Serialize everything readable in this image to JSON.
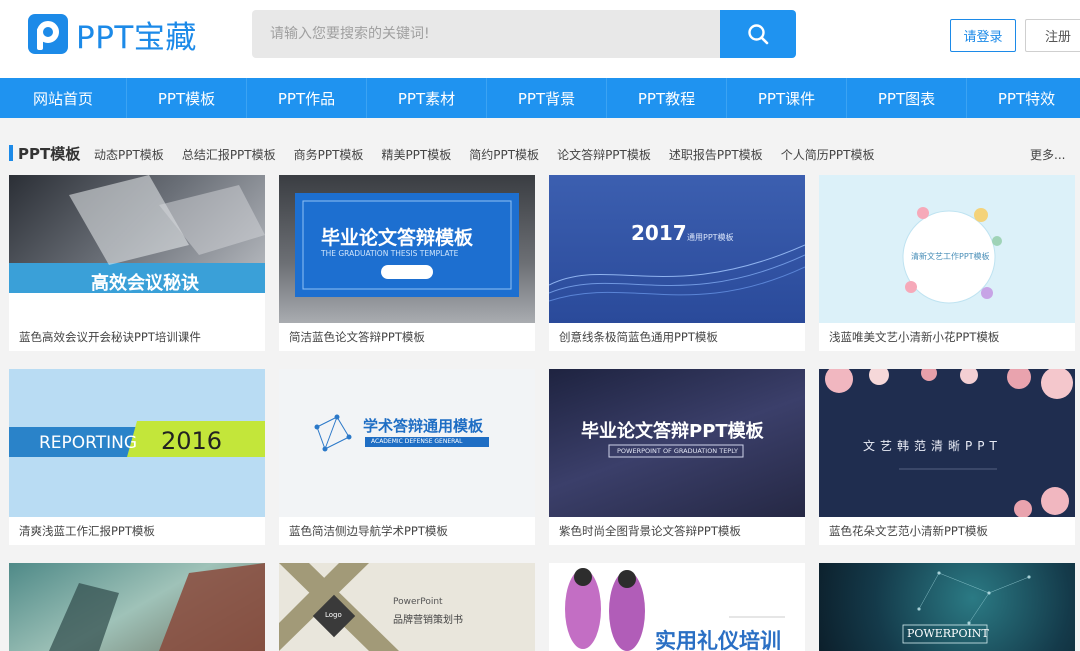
{
  "logo": {
    "text": "PPT宝藏",
    "color": "#1c8ae8"
  },
  "search": {
    "placeholder": "请输入您要搜索的关键词!",
    "icon": "search-icon"
  },
  "auth": {
    "login": "请登录",
    "register": "注册"
  },
  "nav": [
    "网站首页",
    "PPT模板",
    "PPT作品",
    "PPT素材",
    "PPT背景",
    "PPT教程",
    "PPT课件",
    "PPT图表",
    "PPT特效"
  ],
  "category": {
    "title": "PPT模板",
    "links": [
      "动态PPT模板",
      "总结汇报PPT模板",
      "商务PPT模板",
      "精美PPT模板",
      "简约PPT模板",
      "论文答辩PPT模板",
      "述职报告PPT模板",
      "个人简历PPT模板"
    ],
    "more": "更多..."
  },
  "cards": [
    {
      "caption": "蓝色高效会议开会秘诀PPT培训课件",
      "thumb_text": "高效会议秘诀"
    },
    {
      "caption": "简洁蓝色论文答辩PPT模板",
      "thumb_text": "毕业论文答辩模板",
      "thumb_sub": "THE GRADUATION THESIS TEMPLATE"
    },
    {
      "caption": "创意线条极简蓝色通用PPT模板",
      "thumb_text": "2017",
      "thumb_sub": "通用PPT模板"
    },
    {
      "caption": "浅蓝唯美文艺小清新小花PPT模板",
      "thumb_text": "清新文艺工作PPT模板"
    },
    {
      "caption": "清爽浅蓝工作汇报PPT模板",
      "thumb_text": "REPORTING",
      "thumb_sub": "2016"
    },
    {
      "caption": "蓝色简洁侧边导航学术PPT模板",
      "thumb_text": "学术答辩通用模板",
      "thumb_sub": "ACADEMIC DEFENSE GENERAL"
    },
    {
      "caption": "紫色时尚全图背景论文答辩PPT模板",
      "thumb_text": "毕业论文答辩PPT模板",
      "thumb_sub": "POWERPOINT OF GRADUATION TEPLY"
    },
    {
      "caption": "蓝色花朵文艺范小清新PPT模板",
      "thumb_text": "文艺韩范清晰PPT"
    },
    {
      "caption": "",
      "thumb_text": ""
    },
    {
      "caption": "",
      "thumb_text": "品牌营销策划书",
      "thumb_sub": "PowerPoint",
      "logo": "Logo"
    },
    {
      "caption": "",
      "thumb_text": "实用礼仪培训"
    },
    {
      "caption": "",
      "thumb_text": "POWERPOINT"
    }
  ]
}
